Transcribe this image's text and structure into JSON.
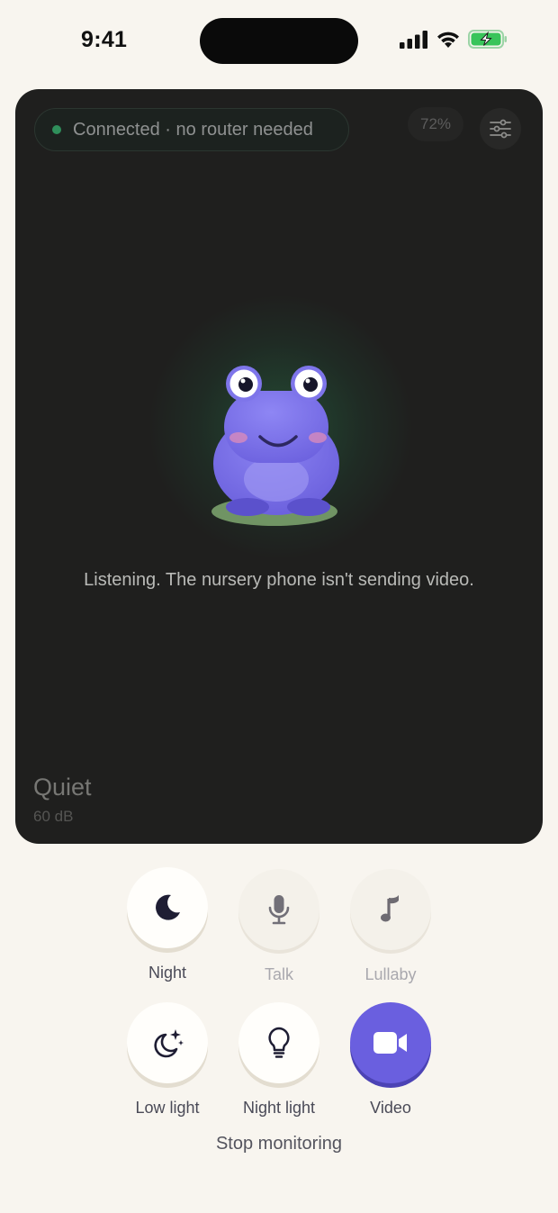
{
  "status_bar": {
    "time": "9:41"
  },
  "monitor": {
    "connection_text": "Connected · no router needed",
    "battery": "72%",
    "message": "Listening. The nursery phone isn't sending video.",
    "sound_level": "Quiet",
    "sound_db": "60 dB"
  },
  "controls": {
    "night": "Night",
    "talk": "Talk",
    "lullaby": "Lullaby",
    "low_light": "Low light",
    "night_light": "Night light",
    "video": "Video"
  },
  "stop_label": "Stop monitoring",
  "colors": {
    "accent": "#6a5fdf",
    "panel": "#1f1f1e",
    "background": "#f8f5ef",
    "connected": "#2f8f5b"
  },
  "icons": [
    "moon-icon",
    "microphone-icon",
    "music-note-icon",
    "moon-stars-icon",
    "lightbulb-icon",
    "video-camera-icon",
    "sliders-icon"
  ]
}
